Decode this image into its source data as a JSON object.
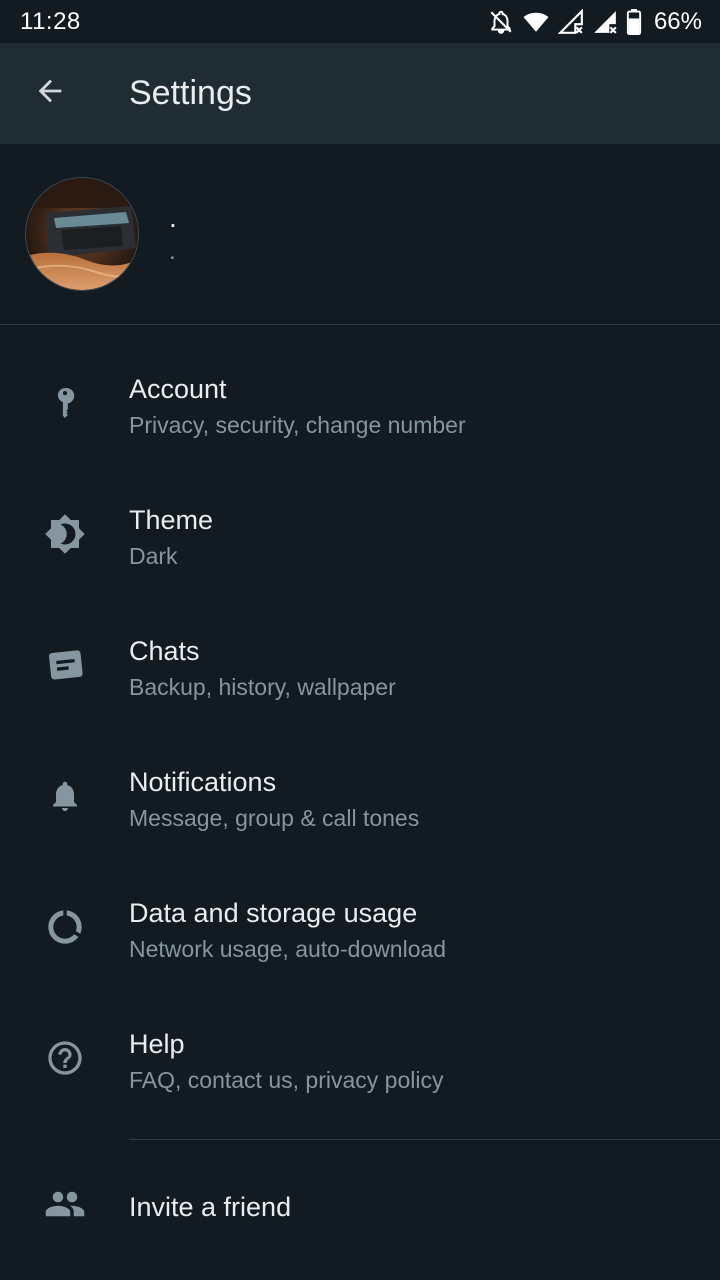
{
  "status_bar": {
    "time": "11:28",
    "battery": "66%",
    "icons": [
      "bell-off-icon",
      "wifi-icon",
      "signal-x-icon",
      "signal-x-icon",
      "battery-icon"
    ]
  },
  "header": {
    "title": "Settings",
    "back_icon": "arrow-left-icon"
  },
  "profile": {
    "name": ".",
    "about": "."
  },
  "items": [
    {
      "title": "Account",
      "subtitle": "Privacy, security, change number",
      "icon": "key-icon"
    },
    {
      "title": "Theme",
      "subtitle": "Dark",
      "icon": "brightness-icon"
    },
    {
      "title": "Chats",
      "subtitle": "Backup, history, wallpaper",
      "icon": "chat-icon"
    },
    {
      "title": "Notifications",
      "subtitle": "Message, group & call tones",
      "icon": "bell-icon"
    },
    {
      "title": "Data and storage usage",
      "subtitle": "Network usage, auto-download",
      "icon": "data-usage-icon"
    },
    {
      "title": "Help",
      "subtitle": "FAQ, contact us, privacy policy",
      "icon": "help-icon"
    },
    {
      "title": "Invite a friend",
      "icon": "people-icon"
    }
  ],
  "colors": {
    "background": "#111b21",
    "header": "#202c33",
    "primary_text": "#e9edef",
    "secondary_text": "#8696a0",
    "icon": "#8696a0"
  }
}
